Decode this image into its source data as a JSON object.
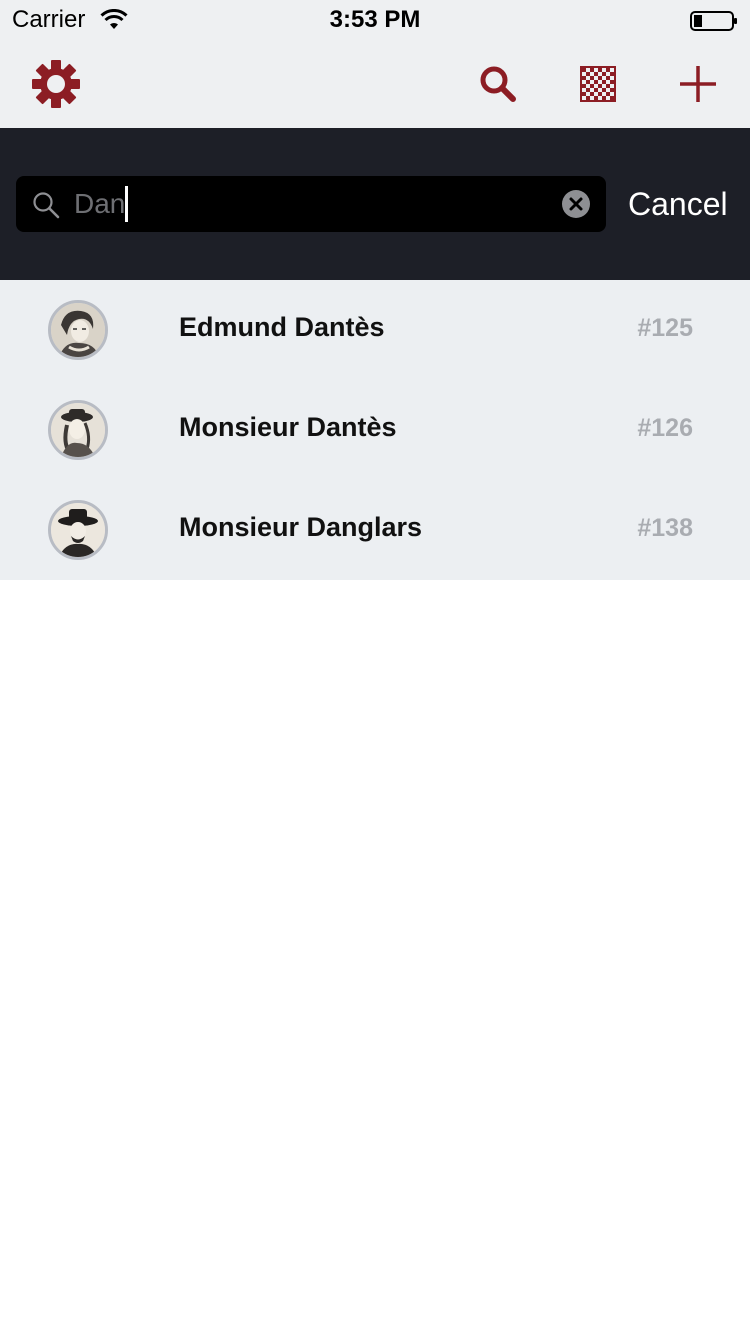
{
  "status_bar": {
    "carrier": "Carrier",
    "time": "3:53 PM"
  },
  "toolbar": {
    "accent_color": "#8c1d24",
    "icons": [
      "gear-icon",
      "search-icon",
      "chessboard-icon",
      "plus-icon"
    ]
  },
  "search": {
    "query": "Dan",
    "cancel_label": "Cancel"
  },
  "results": [
    {
      "name": "Edmund Dantès",
      "number": "#125"
    },
    {
      "name": "Monsieur Dantès",
      "number": "#126"
    },
    {
      "name": "Monsieur Danglars",
      "number": "#138"
    }
  ]
}
